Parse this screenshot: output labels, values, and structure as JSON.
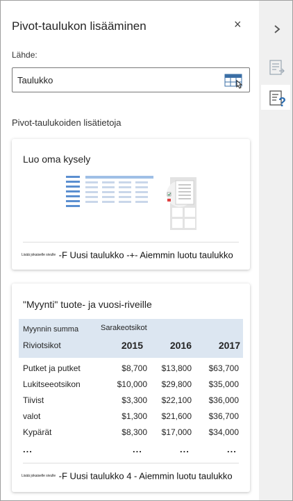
{
  "pane": {
    "title": "Pivot-taulukon lisääminen",
    "close": "×",
    "source_label": "Lähde:",
    "source_value": "Taulukko",
    "section_title": "Pivot-taulukoiden lisätietoja"
  },
  "card1": {
    "title": "Luo oma kysely",
    "footer_small": "Lisää jokaiselle sivulle",
    "footer_big": "-F Uusi taulukko -+- Aiemmin luotu taulukko"
  },
  "card2": {
    "title": "\"Myynti\" tuote- ja vuosi-riveille",
    "header": {
      "values_label": "Myynnin summa",
      "col_label": "Sarakeotsikot",
      "row_label": "Riviotsikot"
    },
    "years": [
      "2015",
      "2016",
      "2017"
    ],
    "rows": [
      {
        "name": "Putket ja putket",
        "v": [
          "$8,700",
          "$13,800",
          "$63,700"
        ]
      },
      {
        "name": "Lukitseeotsikon",
        "v": [
          "$10,000",
          "$29,800",
          "$35,000"
        ]
      },
      {
        "name": "Tiivist",
        "v": [
          "$3,300",
          "$22,100",
          "$36,000"
        ]
      },
      {
        "name": " valot",
        "v": [
          "$1,300",
          "$21,600",
          "$36,700"
        ]
      },
      {
        "name": "Kypärät",
        "v": [
          "$8,300",
          "$17,000",
          "$34,000"
        ]
      }
    ],
    "ellipsis": "...",
    "footer_small": "Lisää jokaiselle sivulle",
    "footer_big": "-F Uusi taulukko 4 - Aiemmin luotu taulukko"
  },
  "rail": {
    "collapse_icon": "chevron-right-icon",
    "items": [
      "recommended-pivot-icon",
      "pivot-help-icon"
    ],
    "selected": "pivot-help-icon"
  },
  "colors": {
    "accent": "#2b6cb0",
    "header_fill": "#dce6f1",
    "rail_bg": "#f0f0f0"
  }
}
